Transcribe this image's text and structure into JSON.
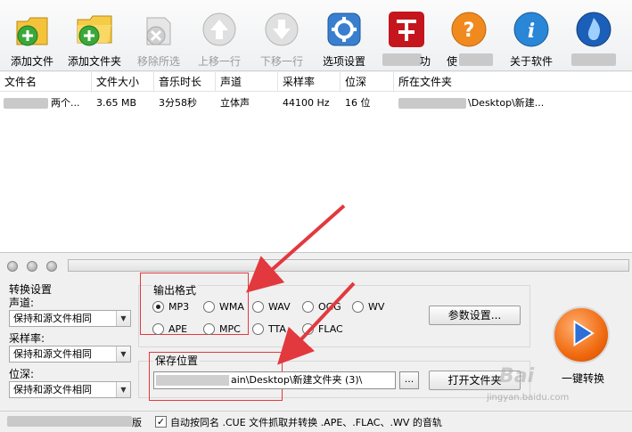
{
  "toolbar": {
    "add_file": "添加文件",
    "add_folder": "添加文件夹",
    "remove_selected": "移除所选",
    "move_up": "上移一行",
    "move_down": "下移一行",
    "options": "选项设置",
    "item7_partial": "功",
    "item8_partial": "使",
    "about": "关于软件"
  },
  "table": {
    "columns": [
      "文件名",
      "文件大小",
      "音乐时长",
      "声道",
      "采样率",
      "位深",
      "所在文件夹"
    ],
    "rows": [
      {
        "name": "两个...",
        "size": "3.65 MB",
        "duration": "3分58秒",
        "channels": "立体声",
        "sample_rate": "44100 Hz",
        "bit_depth": "16 位",
        "folder": "\\Desktop\\新建..."
      }
    ]
  },
  "settings": {
    "title": "转换设置",
    "channel_label": "声道:",
    "channel_value": "保持和源文件相同",
    "samplerate_label": "采样率:",
    "samplerate_value": "保持和源文件相同",
    "bitdepth_label": "位深:",
    "bitdepth_value": "保持和源文件相同"
  },
  "output_format": {
    "title": "输出格式",
    "options": [
      "MP3",
      "WMA",
      "WAV",
      "OGG",
      "WV",
      "APE",
      "MPC",
      "TTA",
      "FLAC"
    ],
    "selected": "MP3",
    "params_button": "参数设置..."
  },
  "save": {
    "title": "保存位置",
    "path": "ain\\Desktop\\新建文件夹 (3)\\",
    "browse": "...",
    "open_folder": "打开文件夹"
  },
  "convert_button": "一键转换",
  "status": {
    "auto_name_checkbox": "自动按同名 .CUE 文件抓取并转换 .APE、.FLAC、.WV 的音轨",
    "checked": true,
    "version_partial": "版"
  },
  "watermark": {
    "text": "Bai",
    "sub": "jingyan.baidu.com"
  },
  "colors": {
    "highlight_red": "#e2393e",
    "accent_orange": "#f06a10"
  }
}
